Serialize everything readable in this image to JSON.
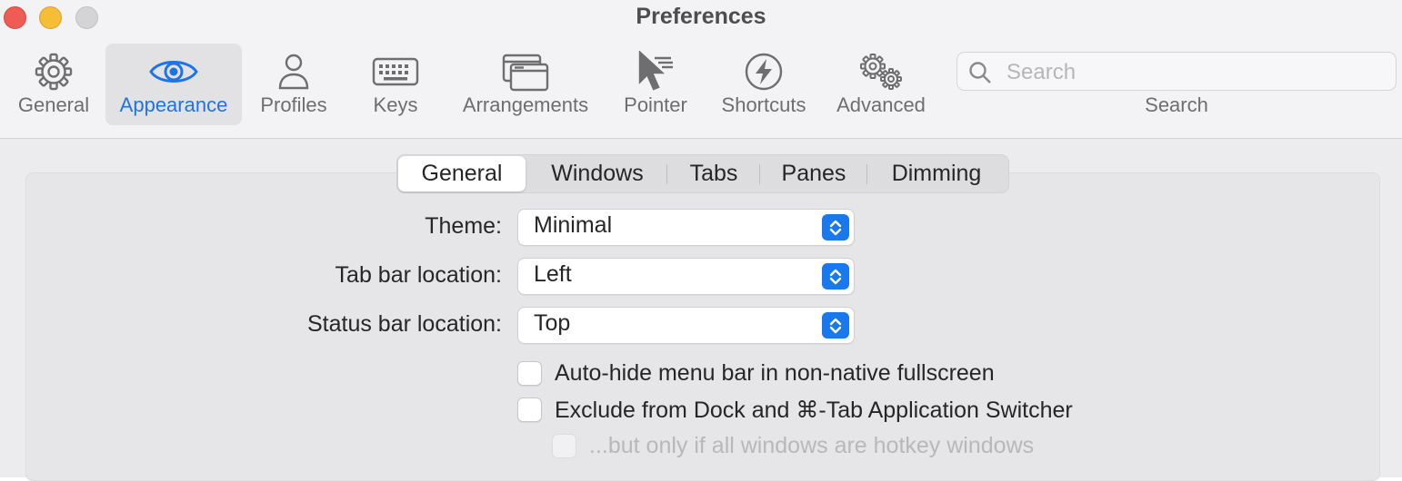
{
  "window": {
    "title": "Preferences"
  },
  "toolbar": {
    "items": [
      {
        "label": "General",
        "icon": "gear-icon"
      },
      {
        "label": "Appearance",
        "icon": "eye-icon",
        "selected": true
      },
      {
        "label": "Profiles",
        "icon": "person-icon"
      },
      {
        "label": "Keys",
        "icon": "keyboard-icon"
      },
      {
        "label": "Arrangements",
        "icon": "windows-icon"
      },
      {
        "label": "Pointer",
        "icon": "pointer-icon"
      },
      {
        "label": "Shortcuts",
        "icon": "bolt-icon"
      },
      {
        "label": "Advanced",
        "icon": "gears-icon"
      }
    ],
    "search": {
      "placeholder": "Search",
      "value": "",
      "label": "Search"
    }
  },
  "tabs": [
    {
      "label": "General",
      "selected": true
    },
    {
      "label": "Windows"
    },
    {
      "label": "Tabs"
    },
    {
      "label": "Panes"
    },
    {
      "label": "Dimming"
    }
  ],
  "settings": {
    "theme": {
      "label": "Theme:",
      "value": "Minimal"
    },
    "tab_bar_location": {
      "label": "Tab bar location:",
      "value": "Left"
    },
    "status_bar_location": {
      "label": "Status bar location:",
      "value": "Top"
    }
  },
  "checkboxes": [
    {
      "label": "Auto-hide menu bar in non-native fullscreen",
      "checked": false,
      "enabled": true
    },
    {
      "label": "Exclude from Dock and ⌘-Tab Application Switcher",
      "checked": false,
      "enabled": true
    },
    {
      "label": "...but only if all windows are hotkey windows",
      "checked": false,
      "enabled": false
    }
  ],
  "colors": {
    "accent": "#1d74e5",
    "stepper": "#1978ee"
  }
}
